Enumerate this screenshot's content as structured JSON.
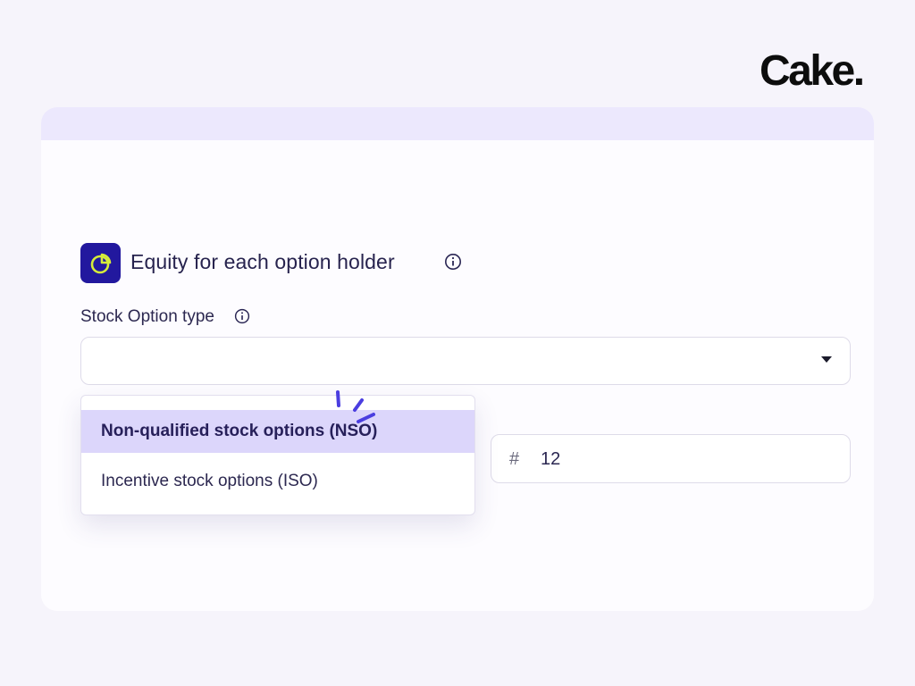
{
  "brand": {
    "logo": "Cake."
  },
  "section": {
    "title": "Equity for each option holder",
    "icon": "pie-chart-icon",
    "accent_color": "#22189e"
  },
  "stock_option_type": {
    "label": "Stock Option type",
    "selected_value": "",
    "options": [
      {
        "label": "Non-qualified stock options (NSO)",
        "highlighted": true
      },
      {
        "label": "Incentive stock options (ISO)",
        "highlighted": false
      }
    ]
  },
  "quantity": {
    "prefix": "#",
    "value": "12"
  },
  "colors": {
    "highlight": "#dcd6fb",
    "band": "#ece8fd",
    "spark": "#4b3ee0"
  }
}
